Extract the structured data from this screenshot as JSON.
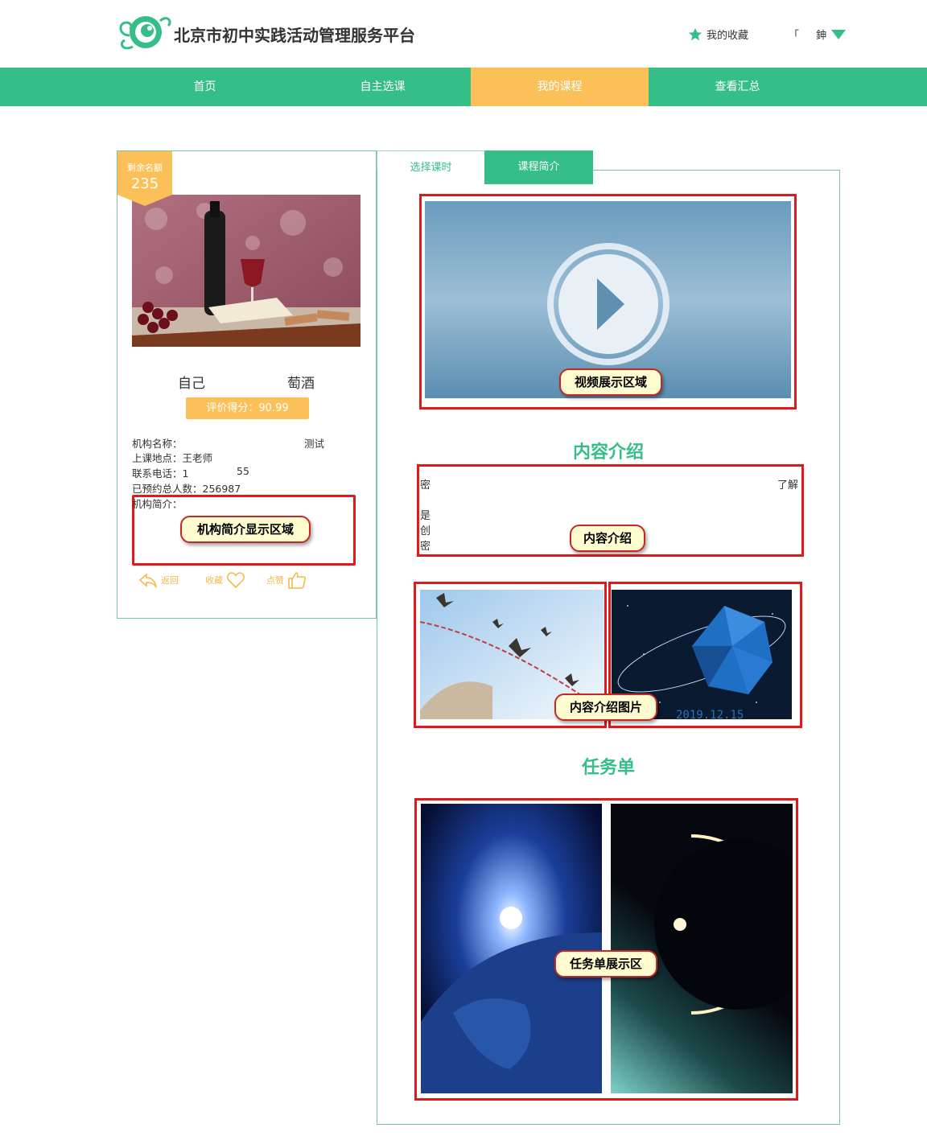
{
  "header": {
    "site_title": "北京市初中实践活动管理服务平台",
    "favorites": "我的收藏",
    "user_name": "「 　 鉮"
  },
  "nav": {
    "items": [
      "首页",
      "自主选课",
      "我的课程",
      "查看汇总"
    ],
    "active": "我的课程"
  },
  "course": {
    "remaining_label": "剩余名额",
    "remaining_count": "235",
    "title": "自己　　　　　　萄酒",
    "score": "评价得分：90.99",
    "org_name_label": "机构名称：",
    "org_name_value": "测试",
    "location": "上课地点：王老师",
    "phone_label": "联系电话：1",
    "phone_value": "55",
    "total_booked": "已预约总人数：256987",
    "org_intro_label": "机构简介：",
    "org_intro_callout": "机构简介显示区域"
  },
  "actions": {
    "back": "返回",
    "favorite": "收藏",
    "like": "点赞"
  },
  "tabs": {
    "lessons": "选择课时",
    "intro": "课程简介"
  },
  "panel": {
    "video_callout": "视频展示区域",
    "content_heading": "内容介绍",
    "content_lines": [
      "密",
      "了解",
      "是",
      "创",
      "密"
    ],
    "content_callout": "内容介绍",
    "images_callout": "内容介绍图片",
    "task_heading": "任务单",
    "task_callout": "任务单展示区"
  },
  "colors": {
    "primary_green": "#36be88",
    "accent_orange": "#fbc058",
    "callout_border": "#e01a1a"
  }
}
